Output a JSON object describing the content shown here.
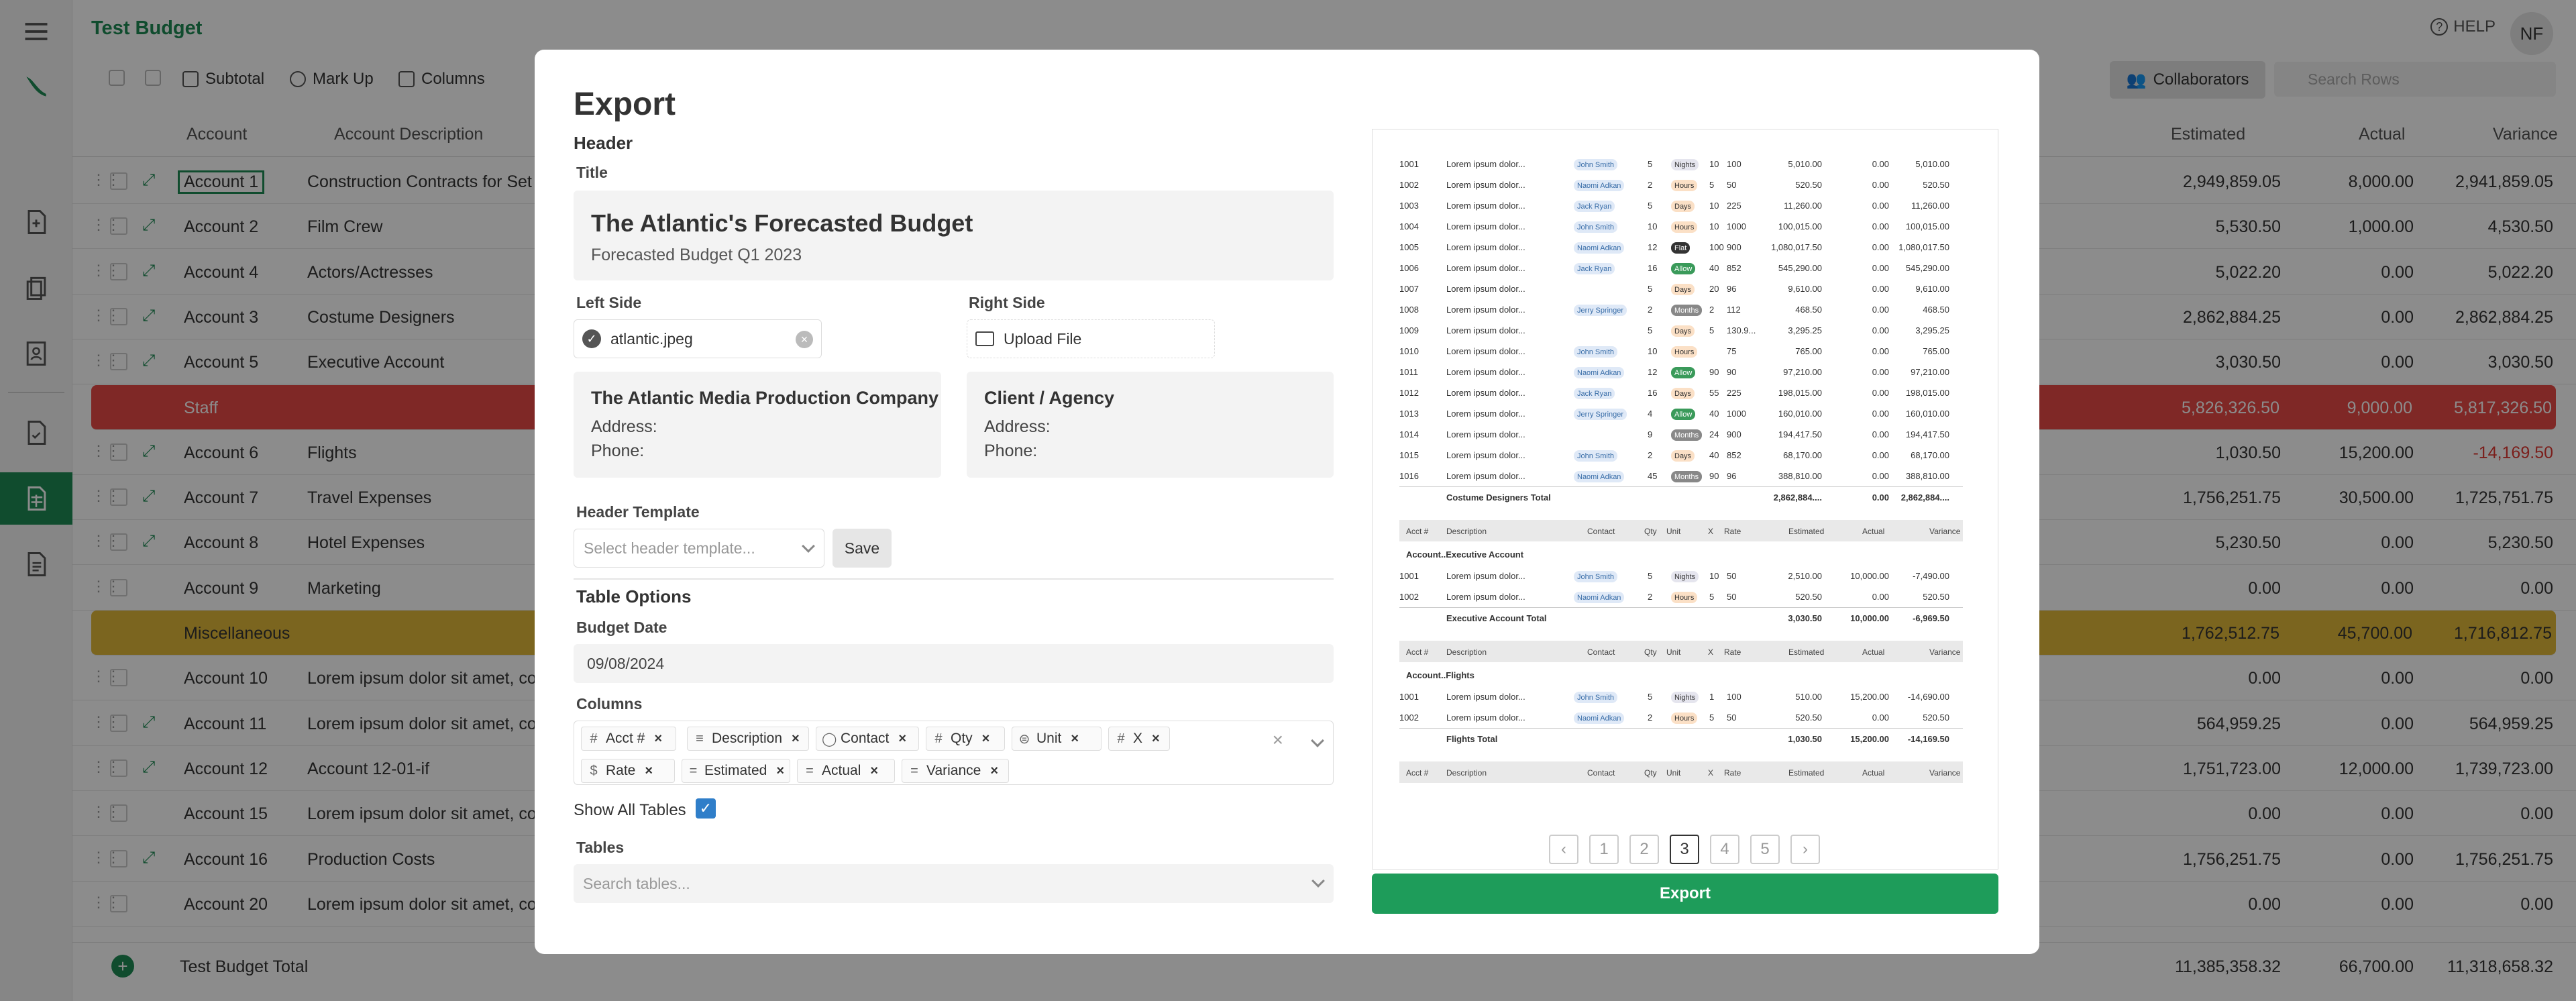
{
  "app": {
    "title": "Test Budget",
    "help": "HELP",
    "avatar": "NF",
    "toolbar": [
      "Subtotal",
      "Mark Up",
      "Columns"
    ],
    "collaborators": "Collaborators",
    "search_placeholder": "Search Rows"
  },
  "grid": {
    "headers": {
      "account": "Account",
      "description": "Account Description",
      "estimated": "Estimated",
      "actual": "Actual",
      "variance": "Variance"
    },
    "rows": [
      {
        "account": "Account 1",
        "description": "Construction Contracts for Set",
        "estimated": "2,949,859.05",
        "actual": "8,000.00",
        "variance": "2,941,859.05"
      },
      {
        "account": "Account 2",
        "description": "Film Crew",
        "estimated": "5,530.50",
        "actual": "1,000.00",
        "variance": "4,530.50"
      },
      {
        "account": "Account 4",
        "description": "Actors/Actresses",
        "estimated": "5,022.20",
        "actual": "0.00",
        "variance": "5,022.20"
      },
      {
        "account": "Account 3",
        "description": "Costume Designers",
        "estimated": "2,862,884.25",
        "actual": "0.00",
        "variance": "2,862,884.25"
      },
      {
        "account": "Account 5",
        "description": "Executive Account",
        "estimated": "3,030.50",
        "actual": "0.00",
        "variance": "3,030.50"
      },
      {
        "account": "Staff",
        "description": "",
        "estimated": "5,826,326.50",
        "actual": "9,000.00",
        "variance": "5,817,326.50"
      },
      {
        "account": "Account 6",
        "description": "Flights",
        "estimated": "1,030.50",
        "actual": "15,200.00",
        "variance": "-14,169.50"
      },
      {
        "account": "Account 7",
        "description": "Travel Expenses",
        "estimated": "1,756,251.75",
        "actual": "30,500.00",
        "variance": "1,725,751.75"
      },
      {
        "account": "Account 8",
        "description": "Hotel Expenses",
        "estimated": "5,230.50",
        "actual": "0.00",
        "variance": "5,230.50"
      },
      {
        "account": "Account 9",
        "description": "Marketing",
        "estimated": "0.00",
        "actual": "0.00",
        "variance": "0.00"
      },
      {
        "account": "Miscellaneous",
        "description": "",
        "estimated": "1,762,512.75",
        "actual": "45,700.00",
        "variance": "1,716,812.75"
      },
      {
        "account": "Account 10",
        "description": "Lorem ipsum dolor sit amet, co",
        "estimated": "0.00",
        "actual": "0.00",
        "variance": "0.00"
      },
      {
        "account": "Account 11",
        "description": "Lorem ipsum dolor sit amet, co",
        "estimated": "564,959.25",
        "actual": "0.00",
        "variance": "564,959.25"
      },
      {
        "account": "Account 12",
        "description": "Account 12-01-if",
        "estimated": "1,751,723.00",
        "actual": "12,000.00",
        "variance": "1,739,723.00"
      },
      {
        "account": "Account 15",
        "description": "Lorem ipsum dolor sit amet, co",
        "estimated": "0.00",
        "actual": "0.00",
        "variance": "0.00"
      },
      {
        "account": "Account 16",
        "description": "Production Costs",
        "estimated": "1,756,251.75",
        "actual": "0.00",
        "variance": "1,756,251.75"
      },
      {
        "account": "Account 20",
        "description": "Lorem ipsum dolor sit amet, co",
        "estimated": "0.00",
        "actual": "0.00",
        "variance": "0.00"
      }
    ],
    "total": {
      "label": "Test Budget Total",
      "estimated": "11,385,358.32",
      "actual": "66,700.00",
      "variance": "11,318,658.32"
    }
  },
  "modal": {
    "title": "Export",
    "header_section": "Header",
    "title_label": "Title",
    "header_title": "The Atlantic's Forecasted Budget",
    "header_subtitle": "Forecasted Budget Q1 2023",
    "left_side_label": "Left Side",
    "left_file": "atlantic.jpeg",
    "right_side_label": "Right Side",
    "upload_label": "Upload File",
    "left_box": {
      "name": "The Atlantic Media Production Company",
      "address": "Address:",
      "phone": "Phone:"
    },
    "right_box": {
      "name": "Client / Agency",
      "address": "Address:",
      "phone": "Phone:"
    },
    "header_template_label": "Header Template",
    "header_template_placeholder": "Select header template...",
    "save_label": "Save",
    "table_options": "Table Options",
    "budget_date_label": "Budget Date",
    "budget_date": "09/08/2024",
    "columns_label": "Columns",
    "columns": [
      "Acct #",
      "Description",
      "Contact",
      "Qty",
      "Unit",
      "X",
      "Rate",
      "Estimated",
      "Actual",
      "Variance"
    ],
    "show_all_tables_label": "Show All Tables",
    "show_all_tables": true,
    "tables_label": "Tables",
    "tables_placeholder": "Search tables...",
    "export_button": "Export",
    "pages": [
      "1",
      "2",
      "3",
      "4",
      "5"
    ],
    "current_page": "3"
  },
  "preview": {
    "costume_rows": [
      [
        "1001",
        "Lorem ipsum dolor...",
        "John Smith",
        "5",
        "Nights",
        "10",
        "100",
        "5,010.00",
        "0.00",
        "5,010.00"
      ],
      [
        "1002",
        "Lorem ipsum dolor...",
        "Naomi Adkan",
        "2",
        "Hours",
        "5",
        "50",
        "520.50",
        "0.00",
        "520.50"
      ],
      [
        "1003",
        "Lorem ipsum dolor...",
        "Jack Ryan",
        "5",
        "Days",
        "10",
        "225",
        "11,260.00",
        "0.00",
        "11,260.00"
      ],
      [
        "1004",
        "Lorem ipsum dolor...",
        "John Smith",
        "10",
        "Hours",
        "10",
        "1000",
        "100,015.00",
        "0.00",
        "100,015.00"
      ],
      [
        "1005",
        "Lorem ipsum dolor...",
        "Naomi Adkan",
        "12",
        "Flat",
        "100",
        "900",
        "1,080,017.50",
        "0.00",
        "1,080,017.50"
      ],
      [
        "1006",
        "Lorem ipsum dolor...",
        "Jack Ryan",
        "16",
        "Allow",
        "40",
        "852",
        "545,290.00",
        "0.00",
        "545,290.00"
      ],
      [
        "1007",
        "Lorem ipsum dolor...",
        "",
        "5",
        "Days",
        "20",
        "96",
        "9,610.00",
        "0.00",
        "9,610.00"
      ],
      [
        "1008",
        "Lorem ipsum dolor...",
        "Jerry Springer",
        "2",
        "Months",
        "2",
        "112",
        "468.50",
        "0.00",
        "468.50"
      ],
      [
        "1009",
        "Lorem ipsum dolor...",
        "",
        "5",
        "Days",
        "5",
        "130.9...",
        "3,295.25",
        "0.00",
        "3,295.25"
      ],
      [
        "1010",
        "Lorem ipsum dolor...",
        "John Smith",
        "10",
        "Hours",
        "",
        "75",
        "765.00",
        "0.00",
        "765.00"
      ],
      [
        "1011",
        "Lorem ipsum dolor...",
        "Naomi Adkan",
        "12",
        "Allow",
        "90",
        "90",
        "97,210.00",
        "0.00",
        "97,210.00"
      ],
      [
        "1012",
        "Lorem ipsum dolor...",
        "Jack Ryan",
        "16",
        "Days",
        "55",
        "225",
        "198,015.00",
        "0.00",
        "198,015.00"
      ],
      [
        "1013",
        "Lorem ipsum dolor...",
        "Jerry Springer",
        "4",
        "Allow",
        "40",
        "1000",
        "160,010.00",
        "0.00",
        "160,010.00"
      ],
      [
        "1014",
        "Lorem ipsum dolor...",
        "",
        "9",
        "Months",
        "24",
        "900",
        "194,417.50",
        "0.00",
        "194,417.50"
      ],
      [
        "1015",
        "Lorem ipsum dolor...",
        "John Smith",
        "2",
        "Days",
        "40",
        "852",
        "68,170.00",
        "0.00",
        "68,170.00"
      ],
      [
        "1016",
        "Lorem ipsum dolor...",
        "Naomi Adkan",
        "45",
        "Months",
        "90",
        "96",
        "388,810.00",
        "0.00",
        "388,810.00"
      ]
    ],
    "costume_total": {
      "label": "Costume Designers Total",
      "estimated": "2,862,884....",
      "actual": "0.00",
      "variance": "2,862,884...."
    },
    "table_header": [
      "Acct #",
      "Description",
      "Contact",
      "Qty",
      "Unit",
      "X",
      "Rate",
      "Estimated",
      "Actual",
      "Variance"
    ],
    "exec_account": "Account..Executive Account",
    "exec_rows": [
      [
        "1001",
        "Lorem ipsum dolor...",
        "John Smith",
        "5",
        "Nights",
        "10",
        "50",
        "2,510.00",
        "10,000.00",
        "-7,490.00"
      ],
      [
        "1002",
        "Lorem ipsum dolor...",
        "Naomi Adkan",
        "2",
        "Hours",
        "5",
        "50",
        "520.50",
        "0.00",
        "520.50"
      ]
    ],
    "exec_total": {
      "label": "Executive Account Total",
      "estimated": "3,030.50",
      "actual": "10,000.00",
      "variance": "-6,969.50"
    },
    "flights_account": "Account..Flights",
    "flights_rows": [
      [
        "1001",
        "Lorem ipsum dolor...",
        "John Smith",
        "5",
        "Nights",
        "1",
        "100",
        "510.00",
        "15,200.00",
        "-14,690.00"
      ],
      [
        "1002",
        "Lorem ipsum dolor...",
        "Naomi Adkan",
        "2",
        "Hours",
        "5",
        "50",
        "520.50",
        "0.00",
        "520.50"
      ]
    ],
    "flights_total": {
      "label": "Flights Total",
      "estimated": "1,030.50",
      "actual": "15,200.00",
      "variance": "-14,169.50"
    }
  }
}
